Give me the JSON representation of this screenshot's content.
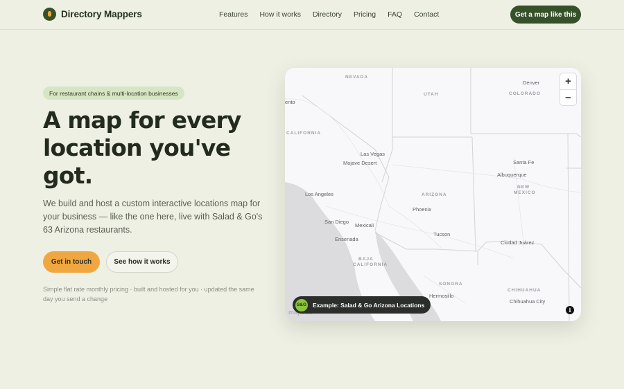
{
  "brand": {
    "name": "Directory Mappers"
  },
  "nav": {
    "links": [
      "Features",
      "How it works",
      "Directory",
      "Pricing",
      "FAQ",
      "Contact"
    ],
    "cta": "Get a map like this"
  },
  "hero": {
    "pill": "For restaurant chains & multi-location businesses",
    "headline": "A map for every location you've got.",
    "lede": "We build and host a custom interactive locations map for your business — like the one here, live with Salad & Go's 63 Arizona restaurants.",
    "primary_button": "Get in touch",
    "secondary_button": "See how it works",
    "fineprint": "Simple flat rate monthly pricing · built and hosted for you · updated the same day you send a change"
  },
  "map": {
    "zoom_in": "+",
    "zoom_out": "−",
    "example_badge": "S&G",
    "example_label": "Example: Salad & Go Arizona Locations",
    "info": "i",
    "attribution": "mapbox",
    "states": [
      "NEVADA",
      "UTAH",
      "COLORADO",
      "CALIFORNIA",
      "ARIZONA",
      "NEW",
      "MEXICO",
      "BAJA",
      "CALIFORNIA",
      "SONORA",
      "CHIHUAHUA"
    ],
    "cities": [
      "Denver",
      "ento",
      "Las Vegas",
      "Mojave Desert",
      "Santa Fe",
      "Albuquerque",
      "Los Angeles",
      "Phoenix",
      "San Diego",
      "Mexicali",
      "Ensenada",
      "Tucson",
      "Ciudad Juárez",
      "Hermosillo",
      "Chihuahua City"
    ]
  }
}
